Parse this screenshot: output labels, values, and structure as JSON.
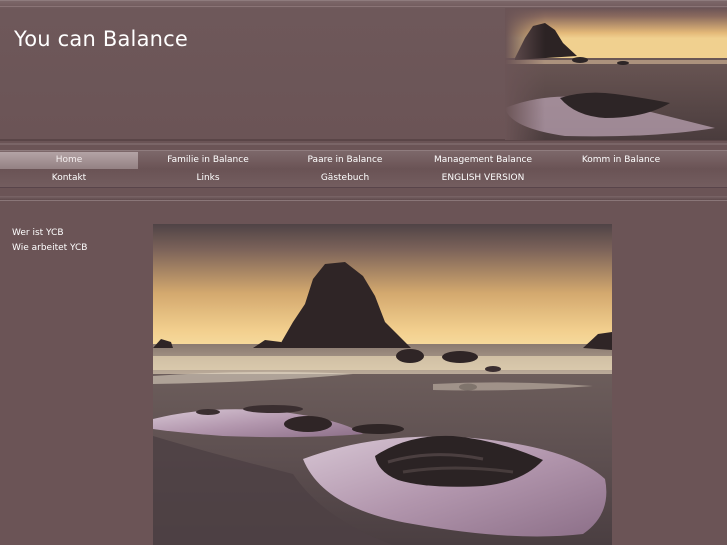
{
  "header": {
    "site_title": "You can Balance",
    "photo_icon": "beach-rock-sunset-image"
  },
  "nav": {
    "row1": [
      {
        "label": "Home",
        "active": true
      },
      {
        "label": "Familie in Balance",
        "active": false
      },
      {
        "label": "Paare in Balance",
        "active": false
      },
      {
        "label": "Management Balance",
        "active": false
      },
      {
        "label": "Komm in Balance",
        "active": false
      }
    ],
    "row2": [
      {
        "label": "Kontakt"
      },
      {
        "label": "Links"
      },
      {
        "label": "Gästebuch"
      },
      {
        "label": "ENGLISH VERSION"
      }
    ]
  },
  "sidebar": {
    "items": [
      {
        "label": "Wer ist YCB"
      },
      {
        "label": "Wie arbeitet YCB"
      }
    ]
  },
  "main": {
    "photo_icon": "beach-rock-sunset-image"
  },
  "colors": {
    "background": "#6b5456",
    "text": "#ffffff",
    "active_tab": "#a99799"
  }
}
